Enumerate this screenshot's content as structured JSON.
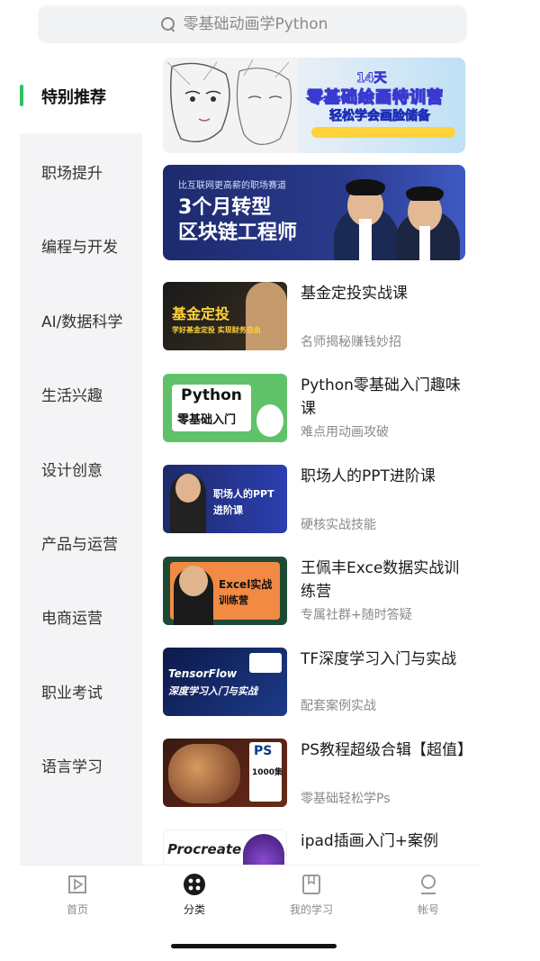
{
  "search": {
    "placeholder": "零基础动画学Python",
    "icon": "search-icon"
  },
  "sidebar": {
    "items": [
      {
        "label": "特别推荐",
        "active": true
      },
      {
        "label": "职场提升"
      },
      {
        "label": "编程与开发"
      },
      {
        "label": "AI/数据科学"
      },
      {
        "label": "生活兴趣"
      },
      {
        "label": "设计创意"
      },
      {
        "label": "产品与运营"
      },
      {
        "label": "电商运营"
      },
      {
        "label": "职业考试"
      },
      {
        "label": "语言学习"
      }
    ],
    "accent_color": "#2ec05c"
  },
  "banners": [
    {
      "days": "14天",
      "title": "零基础绘画特训营",
      "subtitle": "轻松学会画脸储备"
    },
    {
      "tagline": "比互联网更高薪的职场赛道",
      "title_line1": "3个月转型",
      "title_line2": "区块链工程师"
    }
  ],
  "courses": [
    {
      "title": "基金定投实战课",
      "subtitle": "名师揭秘赚钱妙招",
      "thumb_text": "基金定投",
      "thumb_sub": "学好基金定投 实现财务自由"
    },
    {
      "title": "Python零基础入门趣味课",
      "subtitle": "难点用动画攻破",
      "thumb_text": "Python",
      "thumb_sub": "零基础入门"
    },
    {
      "title": "职场人的PPT进阶课",
      "subtitle": "硬核实战技能",
      "thumb_text": "职场人的PPT",
      "thumb_sub": "进阶课"
    },
    {
      "title": "王佩丰Exce数据实战训练营",
      "subtitle": "专属社群+随时答疑",
      "thumb_text": "Excel实战",
      "thumb_sub": "训练营"
    },
    {
      "title": "TF深度学习入门与实战",
      "subtitle": "配套案例实战",
      "thumb_text": "TensorFlow",
      "thumb_sub": "深度学习入门与实战"
    },
    {
      "title": "PS教程超级合辑【超值】",
      "subtitle": "零基础轻松学Ps",
      "thumb_text": "PS",
      "thumb_sub": "1000集"
    },
    {
      "title": "ipad插画入门+案例",
      "subtitle": "",
      "thumb_text": "Procreate",
      "thumb_sub": ""
    }
  ],
  "bottom_nav": [
    {
      "label": "首页",
      "icon": "home-play-icon"
    },
    {
      "label": "分类",
      "icon": "category-grid-icon",
      "active": true
    },
    {
      "label": "我的学习",
      "icon": "bookmark-icon"
    },
    {
      "label": "帐号",
      "icon": "account-icon"
    }
  ]
}
